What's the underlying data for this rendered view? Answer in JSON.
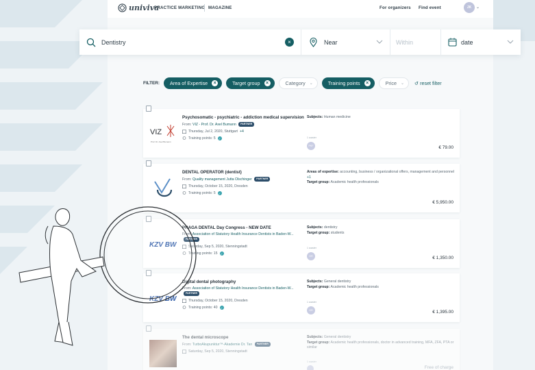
{
  "nav": {
    "logo_text": "univiva",
    "links": [
      "PRACTICE MARKETING",
      "MAGAZINE"
    ],
    "right_links": [
      "For organizers",
      "Find event"
    ],
    "avatar": "JK"
  },
  "search": {
    "query": "Dentistry",
    "near_placeholder": "Near",
    "within_placeholder": "Within",
    "date_placeholder": "date"
  },
  "filters": {
    "label": "FILTER:",
    "active": [
      "Area of Expertise",
      "Target group"
    ],
    "category": "Category",
    "training_points": "Training points",
    "price": "Price",
    "reset": "reset filter"
  },
  "events": [
    {
      "title": "Psychosomatic - psychiatric - addiction medical supervision",
      "from_prefix": "From:",
      "from": "VIZ - Prof. Dr. Axel Bumann",
      "from_extra": "PARTNER",
      "date": "Thursday, Jul 2, 2020, Stuttgart",
      "date_more": "+4",
      "points": "Training points: 5",
      "side_label_1": "Subjects:",
      "side_value_1": "Human medicine",
      "side_label_2": "",
      "side_value_2": "",
      "coach_label": "1 coaster",
      "coach": "PKF",
      "price": "€ 79.00",
      "logo": "VIZ"
    },
    {
      "title": "DENTAL OPERATOR (dentist)",
      "from_prefix": "From:",
      "from": "Quality management Jutta Olschinger",
      "from_extra": "PARTNER",
      "date": "Thursday, October 15, 2020, Dresden",
      "date_more": "",
      "points": "Training points: 5",
      "side_label_1": "Areas of expertise:",
      "side_value_1": "accounting, business / organizational offers, management and personnel",
      "side_more": "+1",
      "side_label_2": "Target group:",
      "side_value_2": "Academic health professionals",
      "coach_label": "",
      "coach": "",
      "price": "€ 5,950.00",
      "logo": "QM"
    },
    {
      "title": "PRAGA DENTAL Day Congress - NEW DATE",
      "from_prefix": "From:",
      "from": "Association of Statutory Health Insurance Dentists in Baden-W...",
      "from_extra": "PARTNER",
      "date": "Saturday, Sep 5, 2020, Stenningstadt",
      "date_more": "",
      "points": "Training points: 15",
      "side_label_1": "Subjects:",
      "side_value_1": "dentistry",
      "side_label_2": "Target group:",
      "side_value_2": "students",
      "coach_label": "1 coaster",
      "coach": "GR",
      "price": "€ 1,350.00",
      "logo": "KZV BW"
    },
    {
      "title": "Digital dental photography",
      "from_prefix": "From:",
      "from": "Association of Statutory Health Insurance Dentists in Baden-W...",
      "from_extra": "PARTNER",
      "date": "Thursday, October 15, 2020, Dresden",
      "date_more": "",
      "points": "Training points: 40",
      "side_label_1": "Subjects:",
      "side_value_1": "General dentistry",
      "side_label_2": "Target group:",
      "side_value_2": "Academic health professionals",
      "coach_label": "1 coaster",
      "coach": "GR",
      "price": "€ 1,395.00",
      "logo": "KZV BW"
    },
    {
      "title": "The dental microscope",
      "from_prefix": "From:",
      "from": "TurboAkupunktur™-Akademie Dr. Tan",
      "from_extra": "PARTNER",
      "date": "Saturday, Sep 5, 2020, Stenningstadt",
      "date_more": "",
      "points": "",
      "side_label_1": "Subjects:",
      "side_value_1": "General dentistry",
      "side_label_2": "Target group:",
      "side_value_2": "Academic health professionals, doctor in advanced training, MFA, ZFA, PTA or similar",
      "coach_label": "1 coaster",
      "coach": "",
      "price": "Free of charge",
      "logo": "photo"
    }
  ],
  "colors": {
    "accent": "#155e63",
    "partner": "#2d4e6a",
    "stripe": "#dde8ee"
  }
}
